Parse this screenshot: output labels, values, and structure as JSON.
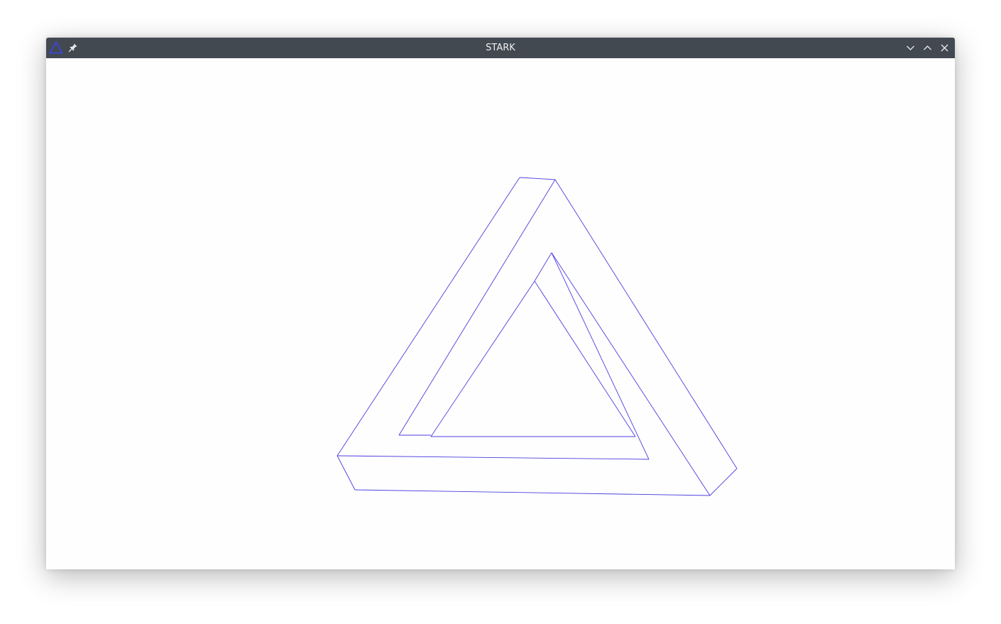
{
  "window": {
    "title": "STARK"
  },
  "titlebar": {
    "app_icon": "triangle-app-icon",
    "pin_icon": "pin-icon",
    "buttons": [
      {
        "icon": "minimize-chevron-down-icon"
      },
      {
        "icon": "maximize-chevron-up-icon"
      },
      {
        "icon": "close-x-icon"
      }
    ]
  },
  "canvas": {
    "figure": "penrose-triangle-wireframe",
    "stroke_color": "#4b3de0",
    "background": "#fefefe"
  },
  "colors": {
    "titlebar": "#434951",
    "title_text": "#eef0f2",
    "accent": "#3b3ec9"
  }
}
